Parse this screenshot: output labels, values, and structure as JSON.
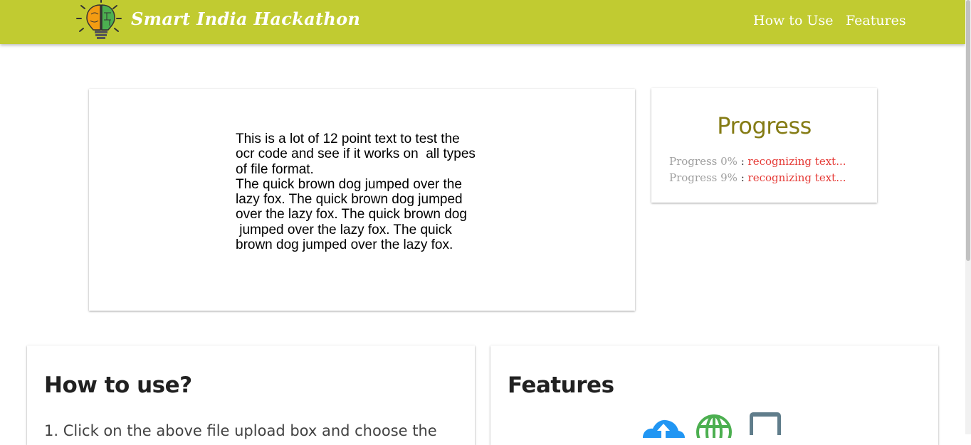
{
  "brand": {
    "name": "Smart India Hackathon"
  },
  "nav": {
    "items": [
      {
        "label": "How to Use"
      },
      {
        "label": "Features"
      }
    ]
  },
  "image_preview": {
    "text_lines": [
      "This is a lot of 12 point text to test the",
      "ocr code and see if it works on  all types",
      "of file format.",
      "The quick brown dog jumped over the",
      "lazy fox. The quick brown dog jumped",
      "over the lazy fox. The quick brown dog",
      " jumped over the lazy fox. The quick",
      "brown dog jumped over the lazy fox."
    ]
  },
  "progress": {
    "title": "Progress",
    "entries": [
      {
        "label": "Progress 0%",
        "separator": ":",
        "status": "recognizing text..."
      },
      {
        "label": "Progress 9%",
        "separator": ":",
        "status": "recognizing text..."
      }
    ]
  },
  "how_to": {
    "title": "How to use?",
    "step_1": "1. Click on the above file upload box and choose the"
  },
  "features": {
    "title": "Features",
    "icons": [
      "cloud-upload-icon",
      "globe-icon",
      "tablet-icon"
    ]
  },
  "colors": {
    "navbar": "#c1cb31",
    "progress_title": "#857c15",
    "status_red": "#e53935",
    "cloud_blue": "#2196f3",
    "globe_green": "#4caf50",
    "tablet_gray": "#607d8b"
  }
}
